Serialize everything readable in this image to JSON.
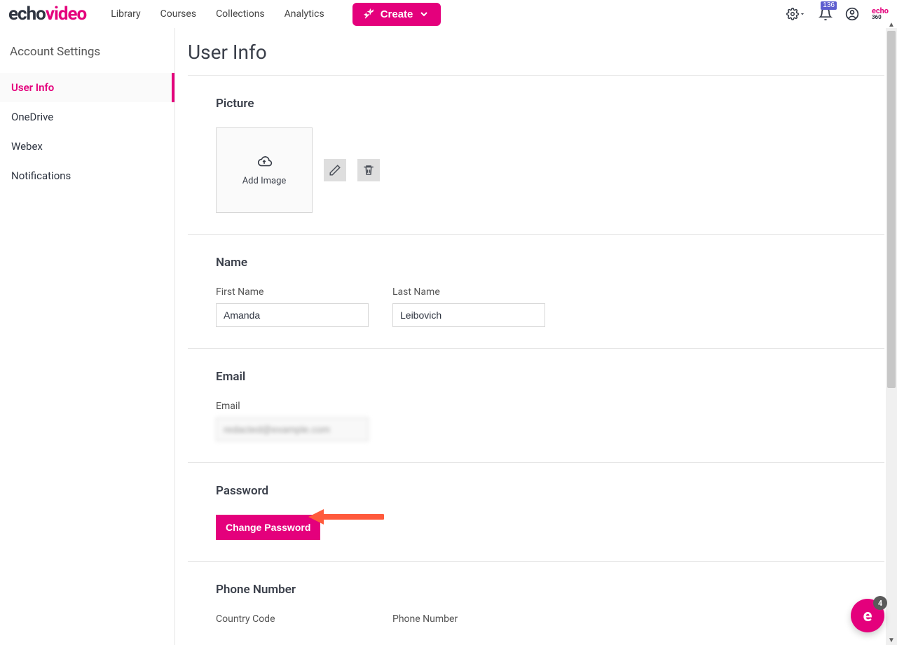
{
  "brand": {
    "part1": "echo",
    "part2": "video"
  },
  "nav": {
    "library": "Library",
    "courses": "Courses",
    "collections": "Collections",
    "analytics": "Analytics",
    "create": "Create"
  },
  "notifications_count": "136",
  "echo360": {
    "line1": "echo",
    "line2": "360"
  },
  "sidebar": {
    "title": "Account Settings",
    "items": [
      {
        "label": "User Info"
      },
      {
        "label": "OneDrive"
      },
      {
        "label": "Webex"
      },
      {
        "label": "Notifications"
      }
    ]
  },
  "page_title": "User Info",
  "picture": {
    "heading": "Picture",
    "add_image": "Add Image"
  },
  "name_section": {
    "heading": "Name",
    "first_label": "First Name",
    "first_value": "Amanda",
    "last_label": "Last Name",
    "last_value": "Leibovich"
  },
  "email_section": {
    "heading": "Email",
    "label": "Email",
    "value": "redacted@example.com"
  },
  "password_section": {
    "heading": "Password",
    "button": "Change Password"
  },
  "phone_section": {
    "heading": "Phone Number",
    "country_label": "Country Code",
    "phone_label": "Phone Number"
  },
  "chat_badge": "4"
}
